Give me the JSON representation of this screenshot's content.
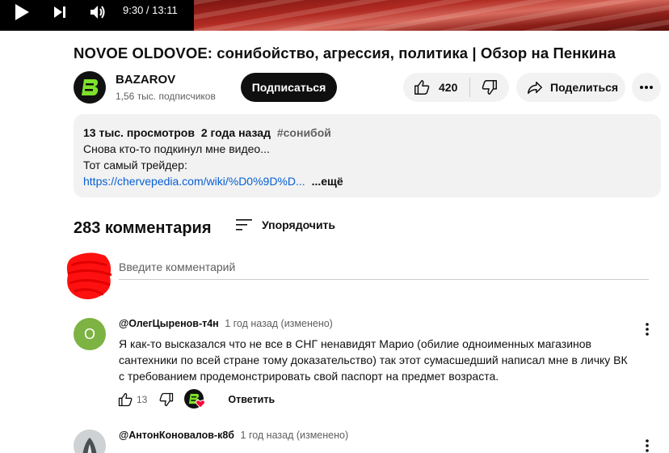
{
  "player": {
    "time": "9:30 / 13:11"
  },
  "video": {
    "title": "NOVOE OLDOVOE: сонибойство, агрессия, политика | Обзор на Пенкина"
  },
  "channel": {
    "name": "BAZAROV",
    "subscribers": "1,56 тыс. подписчиков",
    "avatar_letter": "B",
    "accent": "#7ee22b"
  },
  "actions": {
    "subscribe_label": "Подписаться",
    "like_count": "420",
    "share_label": "Поделиться"
  },
  "description": {
    "views": "13 тыс. просмотров",
    "age": "2 года назад",
    "hashtag": "#сонибой",
    "line1": "Снова кто-то подкинул мне видео...",
    "line2": "Тот самый трейдер:",
    "link": "https://chervepedia.com/wiki/%D0%9D%D...",
    "expand_label": "...ещё"
  },
  "comments": {
    "count_label": "283 комментария",
    "sort_label": "Упорядочить",
    "placeholder": "Введите комментарий",
    "items": [
      {
        "avatar_letter": "О",
        "avatar_color": "#7cb342",
        "author": "@ОлегЦыренов-т4н",
        "time": "1 год назад (изменено)",
        "text": "Я как-то высказался что не все в СНГ ненавидят Марио (обилие одноименных магазинов сантехники по всей стране тому доказательство) так этот сумасшедший написал мне в личку ВК с требованием продемонстрировать свой паспорт на предмет возраста.",
        "likes": "13",
        "reply_label": "Ответить"
      },
      {
        "author": "@АнтонКоновалов-к8б",
        "time": "1 год назад (изменено)"
      }
    ]
  }
}
